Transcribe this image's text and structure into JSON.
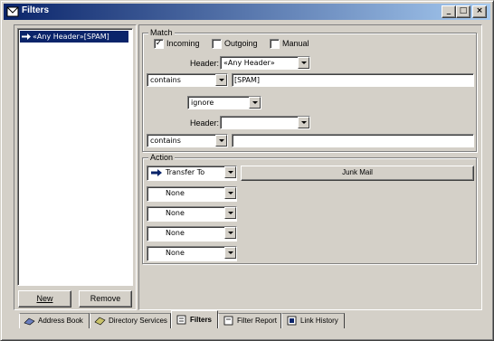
{
  "window": {
    "title": "Filters",
    "controls": {
      "minimize": "_",
      "maximize": "□",
      "close": "×"
    }
  },
  "filter_list": {
    "items": [
      {
        "label": "«Any Header»[SPAM]",
        "selected": true
      }
    ],
    "new_button": "New",
    "remove_button": "Remove"
  },
  "match": {
    "legend": "Match",
    "incoming": {
      "label": "Incoming",
      "checked": true
    },
    "outgoing": {
      "label": "Outgoing",
      "checked": false
    },
    "manual": {
      "label": "Manual",
      "checked": false
    },
    "header1_label": "Header:",
    "header1_value": "«Any Header»",
    "condition1_op": "contains",
    "condition1_value": "[SPAM]",
    "conjunction": "ignore",
    "header2_label": "Header:",
    "header2_value": "",
    "condition2_op": "contains",
    "condition2_value": ""
  },
  "action": {
    "legend": "Action",
    "action1": "Transfer To",
    "mailbox_button": "Junk Mail",
    "action2": "None",
    "action3": "None",
    "action4": "None",
    "action5": "None"
  },
  "tabs": [
    {
      "label": "Address Book",
      "icon": "address-book-icon",
      "active": false
    },
    {
      "label": "Directory Services",
      "icon": "directory-services-icon",
      "active": false
    },
    {
      "label": "Filters",
      "icon": "filters-icon",
      "active": true
    },
    {
      "label": "Filter Report",
      "icon": "filter-report-icon",
      "active": false
    },
    {
      "label": "Link History",
      "icon": "link-history-icon",
      "active": false
    }
  ],
  "colors": {
    "face": "#d4d0c8",
    "title_start": "#0a246a",
    "title_end": "#a6caf0",
    "selection": "#0a246a"
  }
}
